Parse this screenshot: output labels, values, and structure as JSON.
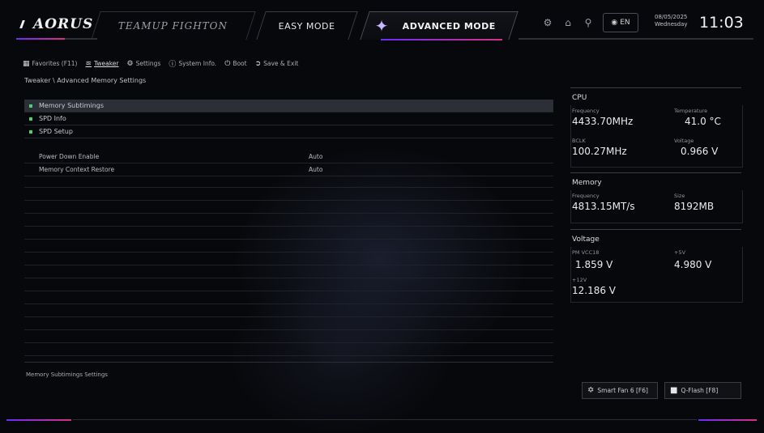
{
  "header": {
    "logo": "AORUS",
    "brand_tab": "TEAMUP FIGHTON",
    "easy_mode": "EASY MODE",
    "advanced_mode": "ADVANCED MODE",
    "lang": "EN",
    "date": "08/05/2025",
    "weekday": "Wednesday",
    "time": "11:03",
    "icons": [
      "settings-icon",
      "home-icon",
      "search-icon"
    ]
  },
  "menu": [
    {
      "label": "Favorites (F11)",
      "icon": "favorites-icon"
    },
    {
      "label": "Tweaker",
      "icon": "tweaker-icon",
      "active": true
    },
    {
      "label": "Settings",
      "icon": "gear-icon"
    },
    {
      "label": "System Info.",
      "icon": "info-icon"
    },
    {
      "label": "Boot",
      "icon": "power-icon"
    },
    {
      "label": "Save & Exit",
      "icon": "exit-icon"
    }
  ],
  "breadcrumb": "Tweaker \\ Advanced Memory Settings",
  "submenus": [
    "Memory Subtimings",
    "SPD Info",
    "SPD Setup"
  ],
  "settings": [
    {
      "label": "Power Down Enable",
      "value": "Auto"
    },
    {
      "label": "Memory Context Restore",
      "value": "Auto"
    }
  ],
  "help_text": "Memory Subtimings Settings",
  "cpu": {
    "title": "CPU",
    "frequency_label": "Frequency",
    "frequency": "4433.70MHz",
    "temperature_label": "Temperature",
    "temperature": "41.0 °C",
    "bclk_label": "BCLK",
    "bclk": "100.27MHz",
    "voltage_label": "Voltage",
    "voltage": "0.966 V"
  },
  "memory": {
    "title": "Memory",
    "frequency_label": "Frequency",
    "frequency": "4813.15MT/s",
    "size_label": "Size",
    "size": "8192MB"
  },
  "voltage": {
    "title": "Voltage",
    "pm_label": "PM VCC18",
    "pm": "1.859 V",
    "v5_label": "+5V",
    "v5": "4.980 V",
    "v12_label": "+12V",
    "v12": "12.186 V"
  },
  "buttons": {
    "smart_fan": "Smart Fan 6 [F6]",
    "qflash": "Q-Flash [F8]"
  },
  "colors": {
    "accent_purple": "#6b2cff",
    "accent_pink": "#d8307f",
    "status_green": "#49d07a",
    "background": "#07080b"
  }
}
